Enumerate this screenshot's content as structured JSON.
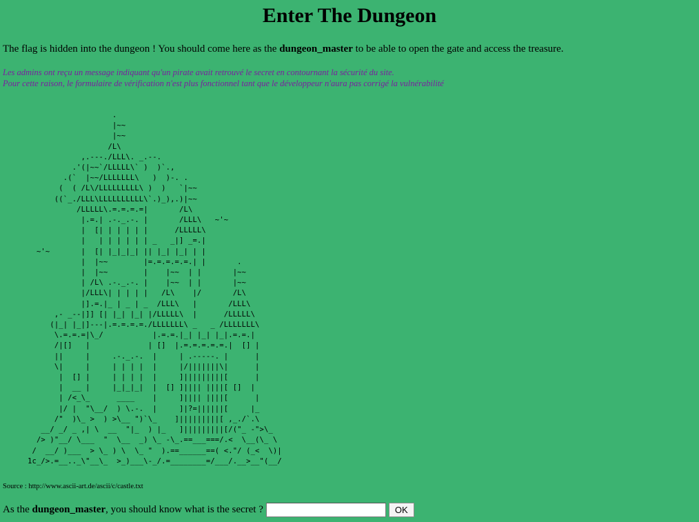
{
  "page": {
    "title": "Enter The Dungeon"
  },
  "intro": {
    "before": "The flag is hidden into the dungeon ! You should come here as the ",
    "role": "dungeon_master",
    "after": " to be able to open the gate and access the treasure."
  },
  "notice": {
    "line1": "Les admins ont reçu un message indiquant qu'un pirate avait retrouvé le secret en contournant la sécurité du site.",
    "line2": "Pour cette raison, le formulaire de vérification n'est plus fonctionnel tant que le développeur n'aura pas corrigé la vulnérabilité"
  },
  "ascii_art": "                   .\n                   |~~\n                   |~~\n                  /L\\\n            ,.---./LLL\\. _.--.\n          .'(|~~`/LLLLL\\` )  )`.,\n        .(`  |~~/LLLLLLL\\   )  )-. .\n       (  ( /L\\/LLLLLLLLL\\ )  )   `|~~\n      ((`_./LLL\\LLLLLLLLLL\\`.)_),.)|~~\n           /LLLLL\\.=.=.=.=|       /L\\\n            |.=.| .-._.-. |       /LLL\\   ~'~\n            |  [| | | | | |      /LLLLL\\\n            |   | | | | | | _   _|] _=.|\n  ~'~       |  [| |_|_|_| || |_| |_| | |\n            |  |~~        |=.=.=.=.=.| |       .\n            |  |~~        |    |~~  | |       |~~\n            | /L\\ .-._.-. |    |~~  | |       |~~\n            |/LLL\\| | | | |   /L\\    |/       /L\\\n            |].=.|_ | _ | _  /LLL\\   |       /LLL\\\n      ,- _--|]] [| |_| |_| |/LLLLL\\  |      /LLLLL\\\n     (|_| |_|]---|.=.=.=.=./LLLLLLL\\ _   _ /LLLLLLL\\\n      \\.=.=.=|\\_/           |.=.=.|_| |_| |_|.=.=.|\n      /|[]   |             | []  |.=.=.=.=.=.|  [] |\n      ||     |     .-._.-.  |     | .-----. |      |\n      \\|     |     | | | |  |     |/|||||||\\|      |\n       |  [] |     | | | |  |     ]|||||||||[      |\n       |  __ |     |_|_|_|  |  [] ]|||| ||||[ []  |\n       | /<_\\_      ____    |     ]|||| ||||[      |\n       |/ |  \"\\__/  ) \\.-.  |     ]|?=||||||[     |_\n      /\"  )\\_ >  ) >\\__ \")`\\_    ]|||||||||[ ,_./`.\\\n   __/ _/ _ ,| \\  __  \"|_  ) |_   ]|||||||||[/(\"_ -\">\\_\n  /> )\"__/ \\___  \"  \\__  _) \\_ -\\_.==___===/.<  \\__(\\_ \\\n /  __/ )___  > \\_ ) \\  \\_ \"  ).==______==( <.\"/ (_<  \\)|\n1c_/>.=__.._\\\"__\\_  >_)___\\-_/.=________=/___/.__>__\"(__/",
  "source": {
    "label": "Source : ",
    "url": "http://www.ascii-art.de/ascii/c/castle.txt"
  },
  "form": {
    "question_before": "As the ",
    "question_role": "dungeon_master",
    "question_after": ", you should know what is the secret ?",
    "input_value": "",
    "submit_label": "OK"
  },
  "colors": {
    "background": "#3cb371",
    "notice_text": "#7a1fa0"
  }
}
